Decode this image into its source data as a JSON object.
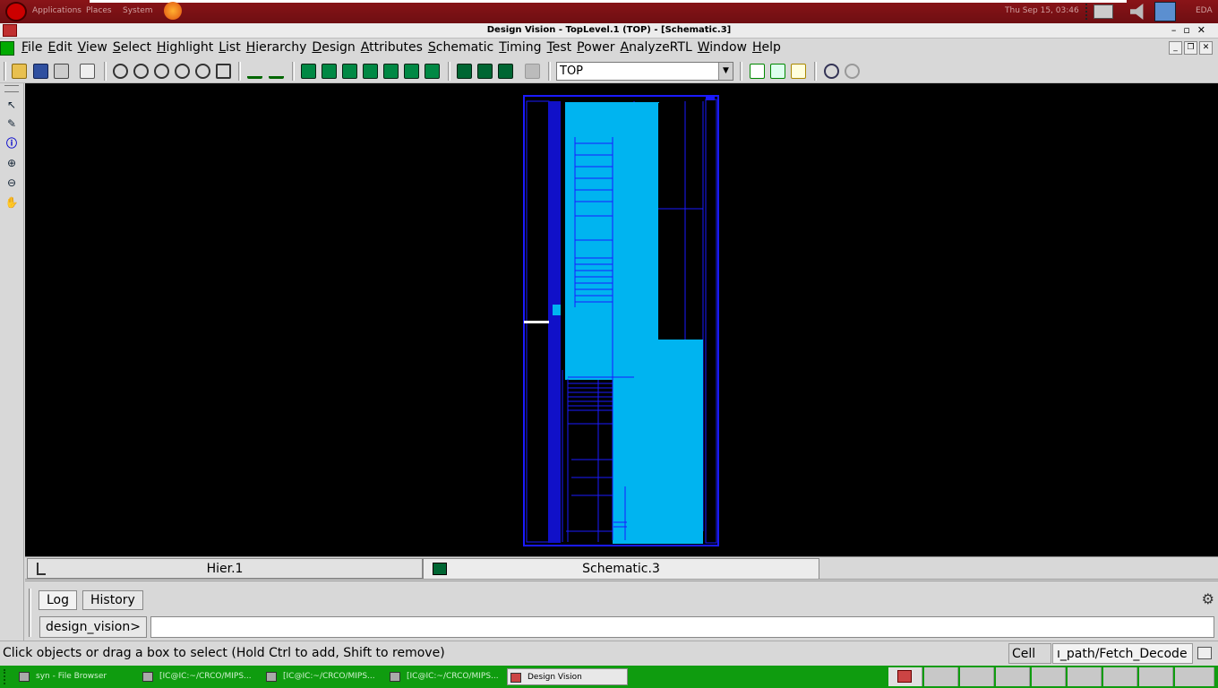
{
  "top_panel": {
    "applications": "Applications",
    "places": "Places",
    "system": "System",
    "clock": "Thu Sep 15, 03:46",
    "user": "EDA"
  },
  "window": {
    "title": "Design Vision - TopLevel.1 (TOP) - [Schematic.3]"
  },
  "menu": [
    "File",
    "Edit",
    "View",
    "Select",
    "Highlight",
    "List",
    "Hierarchy",
    "Design",
    "Attributes",
    "Schematic",
    "Timing",
    "Test",
    "Power",
    "AnalyzeRTL",
    "Window",
    "Help"
  ],
  "toolbar": {
    "design_value": "TOP"
  },
  "view_tabs": {
    "hier": "Hier.1",
    "schematic": "Schematic.3"
  },
  "console": {
    "log_tab": "Log",
    "history_tab": "History",
    "prompt": "design_vision>",
    "input_value": ""
  },
  "status": {
    "message": "Click objects or drag a box to select (Hold Ctrl to add, Shift to remove)",
    "cell_label": "Cell ...",
    "cell_value": "ı_path/Fetch_Decode"
  },
  "taskbar": {
    "items": [
      "syn - File Browser",
      "[IC@IC:~/CRCO/MIPS...",
      "[IC@IC:~/CRCO/MIPS...",
      "[IC@IC:~/CRCO/MIPS...",
      "Design Vision"
    ]
  },
  "colors": {
    "schematic_fill": "#00b4f0",
    "schematic_line": "#1a1aff",
    "canvas": "#000000",
    "taskbar": "#0f9c0f",
    "panel": "#7a1014"
  }
}
